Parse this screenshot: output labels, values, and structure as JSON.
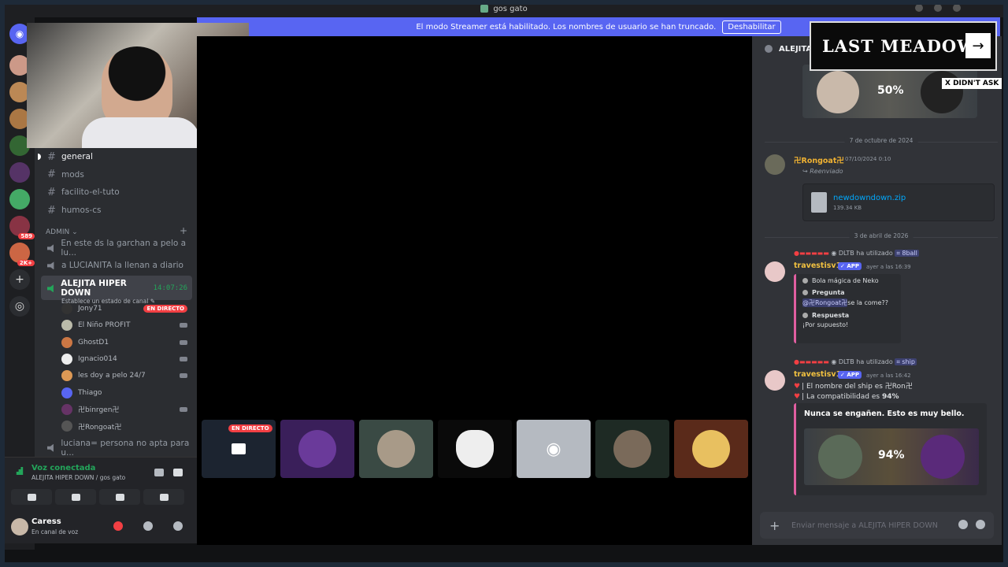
{
  "window": {
    "title": "gos gato"
  },
  "banner": {
    "text": "El modo Streamer está habilitado. Los nombres de usuario se han truncado.",
    "button": "Deshabilitar"
  },
  "servers": {
    "badges": [
      "589",
      "2K+"
    ]
  },
  "channels": {
    "text": [
      "general",
      "mods",
      "facilito-el-tuto",
      "humos-cs"
    ],
    "category": "ADMIN",
    "voice_above": [
      "En este ds la garchan a pelo a lu...",
      "a LUCIANITA la llenan a diario"
    ],
    "active_voice": {
      "name": "ALEJITA HIPER DOWN",
      "timer": "14:07:26",
      "status": "Establece un estado de canal"
    },
    "members": [
      "Jony71",
      "El Niño PROFIT",
      "GhostD1",
      "Ignacio014",
      "les doy a pelo 24/7",
      "Thiago",
      "卍binrgen卍",
      "卍Rongoat卍"
    ],
    "live_badge": "EN DIRECTO",
    "voice_below": "luciana= persona no apta para u..."
  },
  "voice_panel": {
    "status": "Voz conectada",
    "location": "ALEJITA HIPER DOWN / gos gato"
  },
  "user": {
    "name": "Caress",
    "status": "En canal de voz"
  },
  "stream": {
    "live_badge": "EN DIRECTO"
  },
  "chat": {
    "header": "ALEJITA",
    "top_embed_percent": "50%",
    "date1": "7 de octubre de 2024",
    "msg1": {
      "user": "卍Rongoat卍",
      "time": "07/10/2024 0:10",
      "forwarded": "Reenviado",
      "file_name": "newdowndown.zip",
      "file_size": "139.34 KB"
    },
    "date2": "3 de abril de 2026",
    "msg2": {
      "reply_tag": "DLTB",
      "reply_text": "ha utilizado",
      "command": "8ball",
      "user": "travestisv11",
      "app": "APP",
      "time": "ayer a las 16:39",
      "embed_title": "Bola mágica de Neko",
      "q_label": "Pregunta",
      "q_mention": "@卍Rongoat卍",
      "q_text": " se la come??",
      "a_label": "Respuesta",
      "a_text": "¡Por supuesto!"
    },
    "msg3": {
      "reply_tag": "DLTB",
      "reply_text": "ha utilizado",
      "command": "ship",
      "user": "travestisv11",
      "app": "APP",
      "time": "ayer a las 16:42",
      "line1": "| El nombre del ship es 卍Ron卍",
      "line2_prefix": "| La compatibilidad es ",
      "line2_value": "94%",
      "embed_title": "Nunca se engañen. Esto es muy bello.",
      "embed_percent": "94%"
    },
    "composer_placeholder": "Enviar mensaje a ALEJITA HIPER DOWN"
  },
  "overlay": {
    "logo_text": "LAST MEADOW",
    "arrow": "→",
    "tag": "X DIDN'T ASK"
  },
  "colors": {
    "accent": "#5865f2",
    "live": "#f23f43",
    "online": "#23a55a",
    "link": "#00a8fc"
  }
}
